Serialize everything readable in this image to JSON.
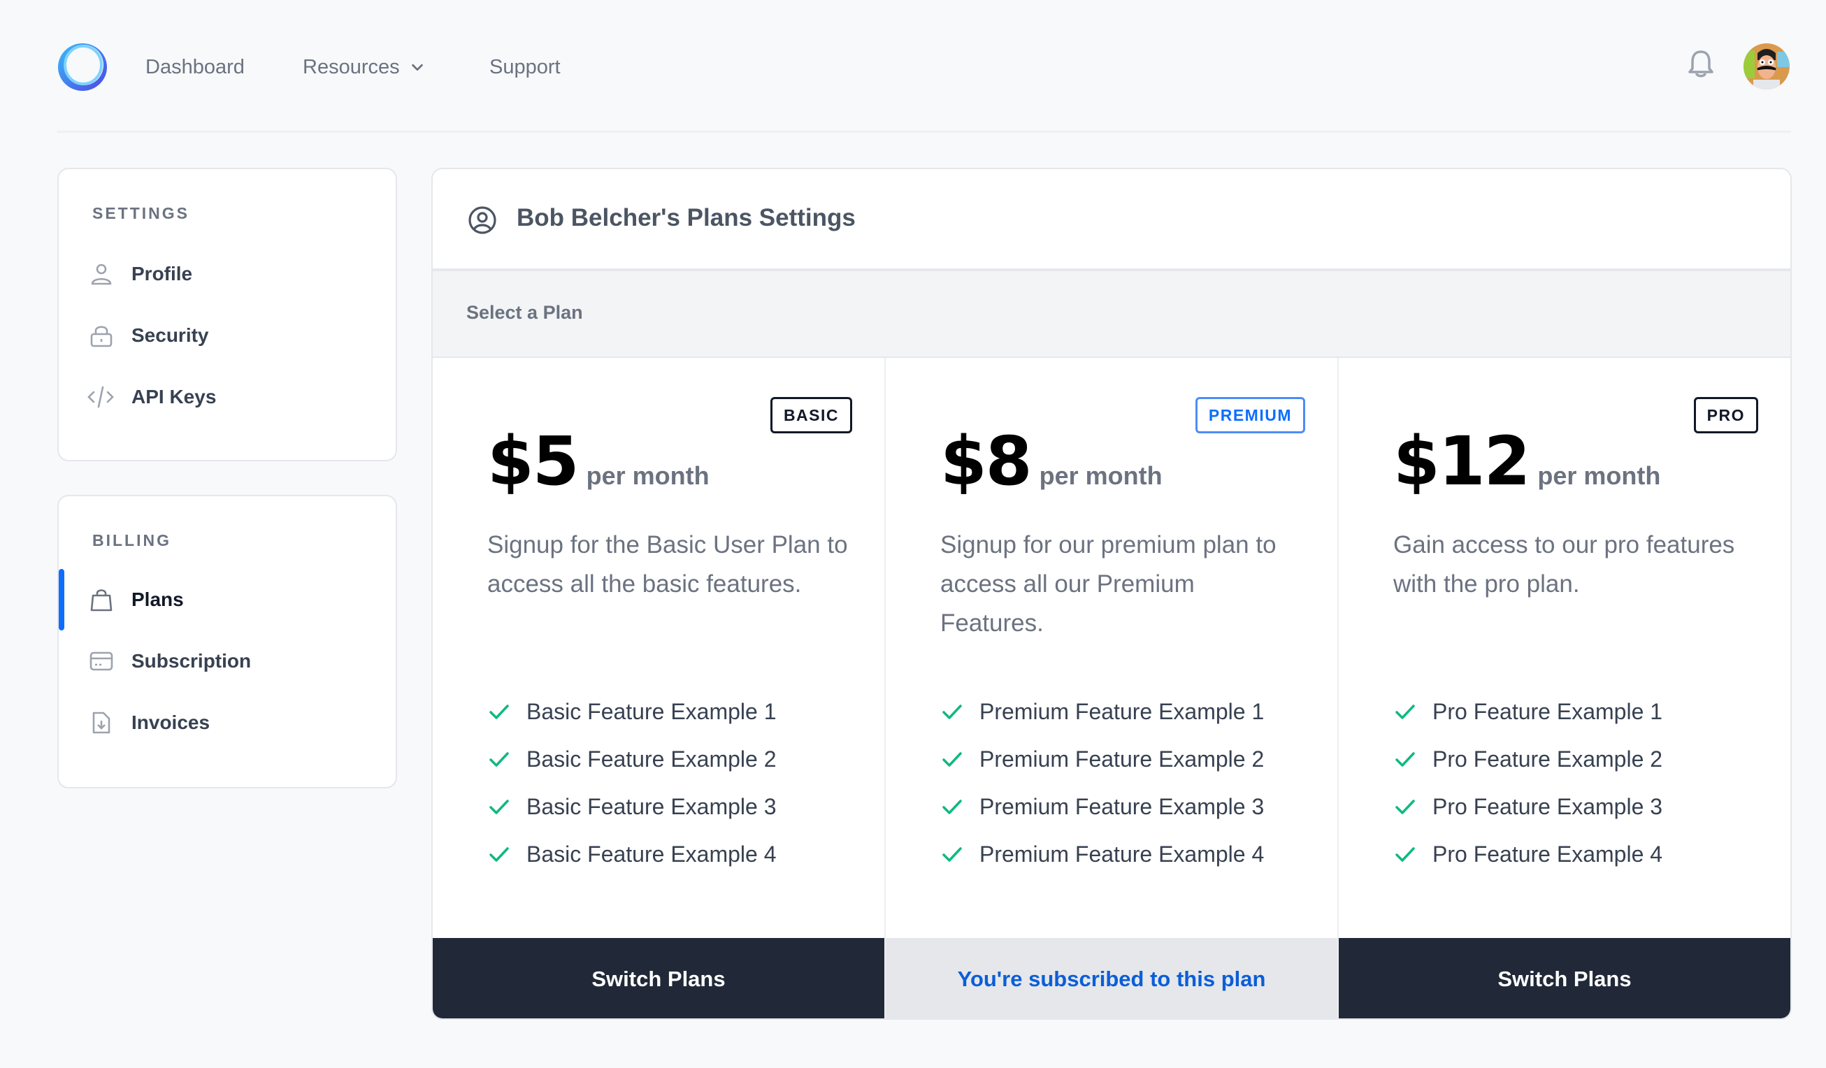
{
  "nav": {
    "logo": "circle-logo",
    "links": [
      {
        "label": "Dashboard"
      },
      {
        "label": "Resources",
        "has_dropdown": true
      },
      {
        "label": "Support"
      }
    ],
    "notifications_icon": "bell-icon",
    "avatar_alt": "Bob Belcher avatar"
  },
  "sidebar": {
    "settings": {
      "heading": "SETTINGS",
      "items": [
        {
          "label": "Profile",
          "icon": "user-icon"
        },
        {
          "label": "Security",
          "icon": "lock-icon"
        },
        {
          "label": "API Keys",
          "icon": "code-icon"
        }
      ]
    },
    "billing": {
      "heading": "BILLING",
      "items": [
        {
          "label": "Plans",
          "icon": "shopping-bag-icon",
          "active": true
        },
        {
          "label": "Subscription",
          "icon": "credit-card-icon"
        },
        {
          "label": "Invoices",
          "icon": "file-download-icon"
        }
      ]
    }
  },
  "main": {
    "title": "Bob Belcher's Plans Settings",
    "section_label": "Select a Plan",
    "plans": [
      {
        "badge": "BASIC",
        "price": "$5",
        "period": "per month",
        "description": "Signup for the Basic User Plan to access all the basic features.",
        "features": [
          "Basic Feature Example 1",
          "Basic Feature Example 2",
          "Basic Feature Example 3",
          "Basic Feature Example 4"
        ],
        "button": "Switch Plans",
        "current": false
      },
      {
        "badge": "PREMIUM",
        "price": "$8",
        "period": "per month",
        "description": "Signup for our premium plan to access all our Premium Features.",
        "features": [
          "Premium Feature Example 1",
          "Premium Feature Example 2",
          "Premium Feature Example 3",
          "Premium Feature Example 4"
        ],
        "button": "You're subscribed to this plan",
        "current": true
      },
      {
        "badge": "PRO",
        "price": "$12",
        "period": "per month",
        "description": "Gain access to our pro features with the pro plan.",
        "features": [
          "Pro Feature Example 1",
          "Pro Feature Example 2",
          "Pro Feature Example 3",
          "Pro Feature Example 4"
        ],
        "button": "Switch Plans",
        "current": false
      }
    ]
  },
  "colors": {
    "accent": "#0d6efd",
    "check": "#10b981",
    "button_dark": "#212938",
    "current_bg": "#e5e7eb",
    "current_text": "#0b5ed7"
  }
}
